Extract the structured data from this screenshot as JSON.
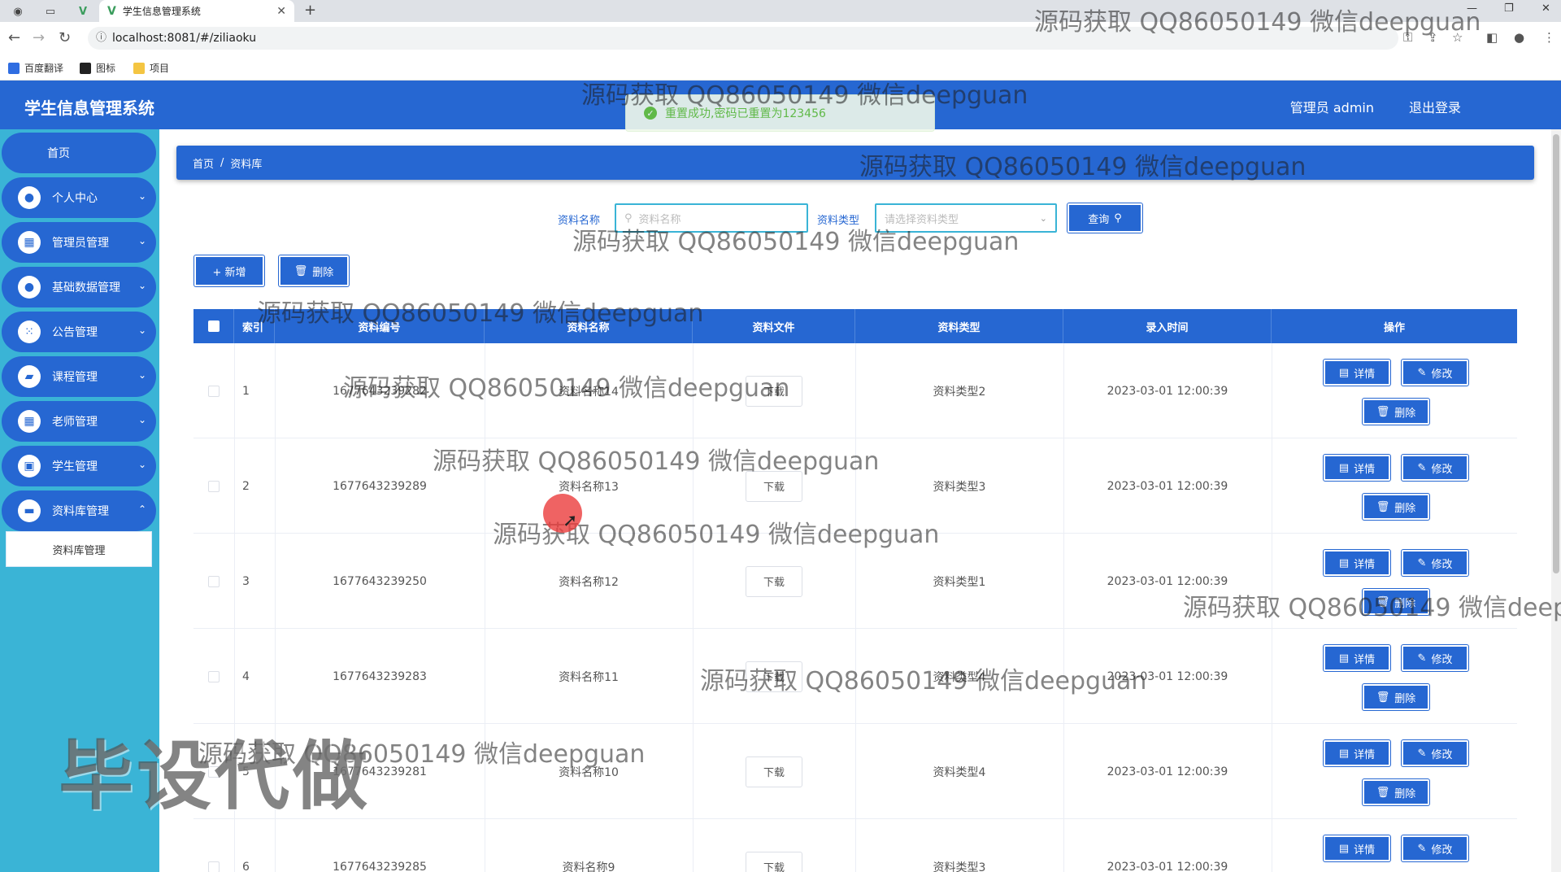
{
  "browser": {
    "tab_title": "学生信息管理系统",
    "url": "localhost:8081/#/ziliaoku",
    "bookmarks": [
      "百度翻译",
      "图标",
      "项目"
    ]
  },
  "header": {
    "app_title": "学生信息管理系统",
    "user_label": "管理员 admin",
    "logout_label": "退出登录"
  },
  "toast": {
    "message": "重置成功,密码已重置为123456"
  },
  "sidebar": {
    "home_label": "首页",
    "items": [
      {
        "label": "个人中心",
        "icon": "person-icon"
      },
      {
        "label": "管理员管理",
        "icon": "grid-icon"
      },
      {
        "label": "基础数据管理",
        "icon": "person-icon"
      },
      {
        "label": "公告管理",
        "icon": "apps-icon"
      },
      {
        "label": "课程管理",
        "icon": "briefcase-icon"
      },
      {
        "label": "老师管理",
        "icon": "grid-icon"
      },
      {
        "label": "学生管理",
        "icon": "bag-icon"
      },
      {
        "label": "资料库管理",
        "icon": "monitor-icon"
      }
    ],
    "submenu_label": "资料库管理"
  },
  "breadcrumb": {
    "home": "首页",
    "separator": "/",
    "current": "资料库"
  },
  "search": {
    "name_label": "资料名称",
    "name_placeholder": "资料名称",
    "type_label": "资料类型",
    "type_placeholder": "请选择资料类型",
    "query_button": "查询"
  },
  "actions": {
    "add_button": "+ 新增",
    "delete_button": "删除"
  },
  "table": {
    "columns": [
      "索引",
      "资料编号",
      "资料名称",
      "资料文件",
      "资料类型",
      "录入时间",
      "操作"
    ],
    "download_label": "下载",
    "op_detail": "详情",
    "op_edit": "修改",
    "op_delete": "删除",
    "rows": [
      {
        "index": "1",
        "code": "1677643239282",
        "name": "资料名称14",
        "type": "资料类型2",
        "time": "2023-03-01 12:00:39"
      },
      {
        "index": "2",
        "code": "1677643239289",
        "name": "资料名称13",
        "type": "资料类型3",
        "time": "2023-03-01 12:00:39"
      },
      {
        "index": "3",
        "code": "1677643239250",
        "name": "资料名称12",
        "type": "资料类型1",
        "time": "2023-03-01 12:00:39"
      },
      {
        "index": "4",
        "code": "1677643239283",
        "name": "资料名称11",
        "type": "资料类型4",
        "time": "2023-03-01 12:00:39"
      },
      {
        "index": "5",
        "code": "1677643239281",
        "name": "资料名称10",
        "type": "资料类型4",
        "time": "2023-03-01 12:00:39"
      },
      {
        "index": "6",
        "code": "1677643239285",
        "name": "资料名称9",
        "type": "资料类型3",
        "time": "2023-03-01 12:00:39"
      }
    ]
  },
  "watermark": {
    "text": "源码获取 QQ86050149 微信deepguan",
    "big_text": "毕设代做"
  },
  "colors": {
    "primary": "#2667d2",
    "sidebar": "#3ab4d6",
    "success": "#67c23a"
  }
}
